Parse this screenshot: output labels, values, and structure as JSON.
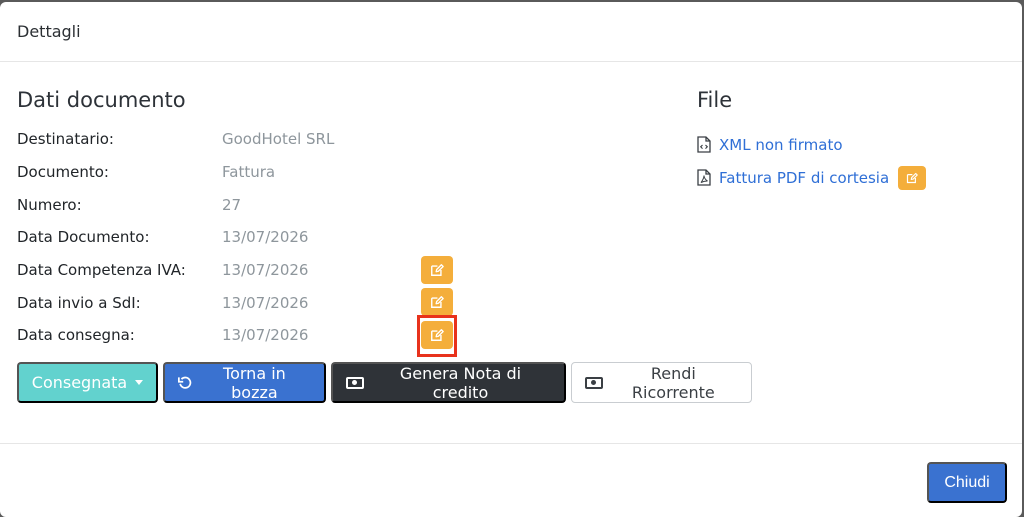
{
  "modal": {
    "title": "Dettagli"
  },
  "document_section": {
    "title": "Dati documento",
    "rows": [
      {
        "label": "Destinatario:",
        "value": "GoodHotel SRL",
        "editable": false
      },
      {
        "label": "Documento:",
        "value": "Fattura",
        "editable": false
      },
      {
        "label": "Numero:",
        "value": "27",
        "editable": false
      },
      {
        "label": "Data Documento:",
        "value": "13/07/2026",
        "editable": false
      },
      {
        "label": "Data Competenza IVA:",
        "value": "13/07/2026",
        "editable": true
      },
      {
        "label": "Data invio a SdI:",
        "value": "13/07/2026",
        "editable": true
      },
      {
        "label": "Data consegna:",
        "value": "13/07/2026",
        "editable": true
      }
    ]
  },
  "file_section": {
    "title": "File",
    "items": [
      {
        "label": "XML non firmato",
        "icon": "code-file-icon"
      },
      {
        "label": "Fattura PDF di cortesia",
        "icon": "pdf-file-icon"
      }
    ]
  },
  "actions": {
    "consegnata": "Consegnata",
    "torna_bozza": "Torna in bozza",
    "genera_nota": "Genera Nota di credito",
    "rendi_ricorrente": "Rendi Ricorrente"
  },
  "footer": {
    "close_label": "Chiudi"
  },
  "colors": {
    "edit": "#f4ae3b",
    "primary": "#3a72d0",
    "teal": "#62d2ce",
    "dark": "#2f3338",
    "link": "#2f6fd6",
    "highlight": "#e8321c"
  }
}
